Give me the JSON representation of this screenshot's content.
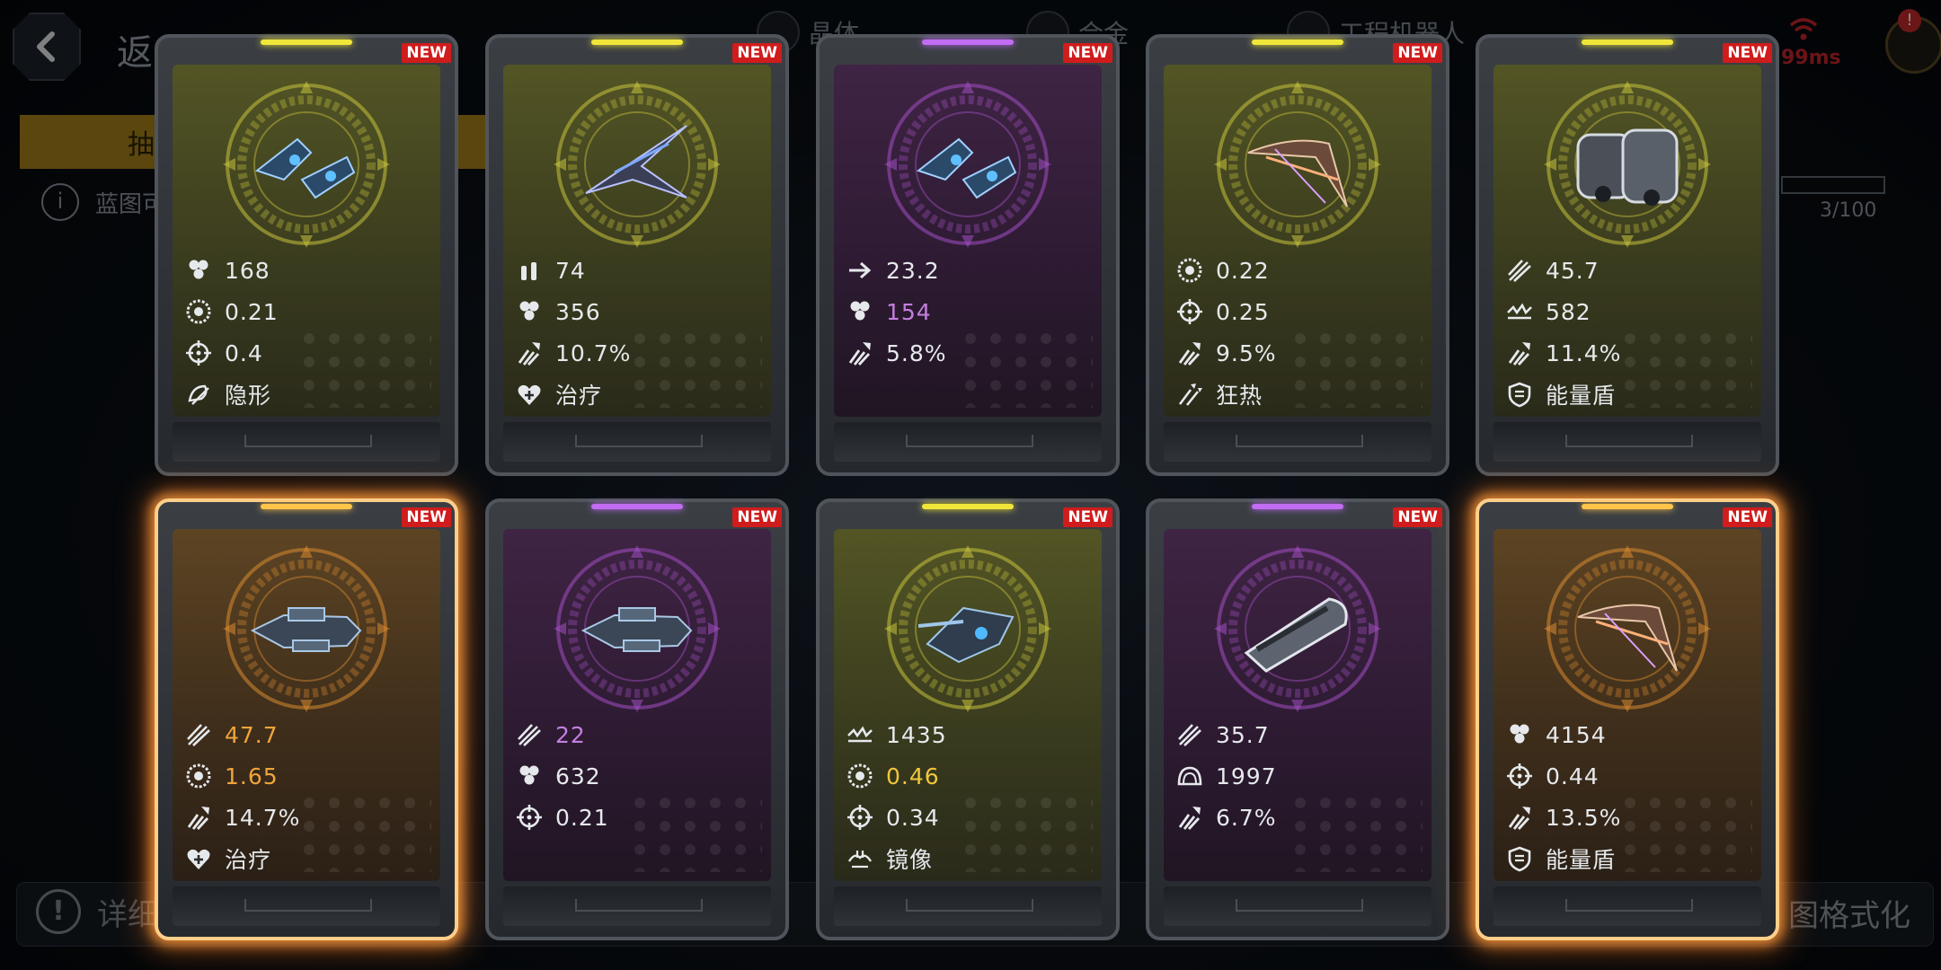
{
  "background": {
    "back_label": "返",
    "resources": [
      "晶体",
      "合金",
      "工程机器人"
    ],
    "ping": "99ms",
    "cart_badge": "!",
    "tab_label": "抽",
    "info_text": "蓝图可",
    "progress_text": "3/100",
    "progress_value": 0.03,
    "detail_label": "详细",
    "format_label": "图格式化"
  },
  "colors": {
    "yellow": "#d8d23a",
    "purple": "#b45fd4",
    "orange": "#f0a43c",
    "new_tag": "#d01c1c"
  },
  "cards": [
    {
      "rarity": "yellow",
      "new": "NEW",
      "ship": "twin-fighter",
      "stats": [
        {
          "icon": "hp-icon",
          "value": "168"
        },
        {
          "icon": "rate-icon",
          "value": "0.21"
        },
        {
          "icon": "target-icon",
          "value": "0.4"
        },
        {
          "icon": "stealth-icon",
          "value": "隐形"
        }
      ]
    },
    {
      "rarity": "yellow",
      "new": "NEW",
      "ship": "arrow-fighter",
      "stats": [
        {
          "icon": "ammo-icon",
          "value": "74"
        },
        {
          "icon": "hp-icon",
          "value": "356"
        },
        {
          "icon": "crit-icon",
          "value": "10.7%"
        },
        {
          "icon": "heal-icon",
          "value": "治疗"
        }
      ]
    },
    {
      "rarity": "purple",
      "new": "NEW",
      "ship": "twin-fighter",
      "stats": [
        {
          "icon": "speed-icon",
          "value": "23.2"
        },
        {
          "icon": "hp-icon",
          "value": "154",
          "color": "purple"
        },
        {
          "icon": "crit-icon",
          "value": "5.8%"
        }
      ]
    },
    {
      "rarity": "yellow",
      "new": "NEW",
      "ship": "claw-ship",
      "stats": [
        {
          "icon": "rate-icon",
          "value": "0.22"
        },
        {
          "icon": "target-icon",
          "value": "0.25"
        },
        {
          "icon": "crit-icon",
          "value": "9.5%"
        },
        {
          "icon": "frenzy-icon",
          "value": "狂热"
        }
      ]
    },
    {
      "rarity": "yellow",
      "new": "NEW",
      "ship": "heavy-cruiser",
      "stats": [
        {
          "icon": "damage-icon",
          "value": "45.7"
        },
        {
          "icon": "armor-icon",
          "value": "582"
        },
        {
          "icon": "crit-icon",
          "value": "11.4%"
        },
        {
          "icon": "shield-icon",
          "value": "能量盾"
        }
      ]
    },
    {
      "rarity": "orange",
      "new": "NEW",
      "glow": true,
      "ship": "battleship",
      "stats": [
        {
          "icon": "damage-icon",
          "value": "47.7",
          "color": "orange"
        },
        {
          "icon": "rate-icon",
          "value": "1.65",
          "color": "orange"
        },
        {
          "icon": "crit-icon",
          "value": "14.7%"
        },
        {
          "icon": "heal-icon",
          "value": "治疗"
        }
      ]
    },
    {
      "rarity": "purple",
      "new": "NEW",
      "ship": "battleship",
      "stats": [
        {
          "icon": "damage-icon",
          "value": "22",
          "color": "purple"
        },
        {
          "icon": "hp-icon",
          "value": "632"
        },
        {
          "icon": "target-icon",
          "value": "0.21"
        }
      ]
    },
    {
      "rarity": "yellow",
      "new": "NEW",
      "ship": "gunship",
      "stats": [
        {
          "icon": "armor-icon",
          "value": "1435"
        },
        {
          "icon": "rate-icon",
          "value": "0.46",
          "color": "gold"
        },
        {
          "icon": "target-icon",
          "value": "0.34"
        },
        {
          "icon": "mirror-icon",
          "value": "镜像"
        }
      ]
    },
    {
      "rarity": "purple",
      "new": "NEW",
      "ship": "cannon-cruiser",
      "stats": [
        {
          "icon": "damage-icon",
          "value": "35.7"
        },
        {
          "icon": "shield-dome-icon",
          "value": "1997"
        },
        {
          "icon": "crit-icon",
          "value": "6.7%"
        }
      ]
    },
    {
      "rarity": "orange",
      "new": "NEW",
      "glow": true,
      "ship": "claw-ship",
      "stats": [
        {
          "icon": "hp-icon",
          "value": "4154"
        },
        {
          "icon": "target-icon",
          "value": "0.44"
        },
        {
          "icon": "crit-icon",
          "value": "13.5%"
        },
        {
          "icon": "shield-icon",
          "value": "能量盾"
        }
      ]
    }
  ]
}
